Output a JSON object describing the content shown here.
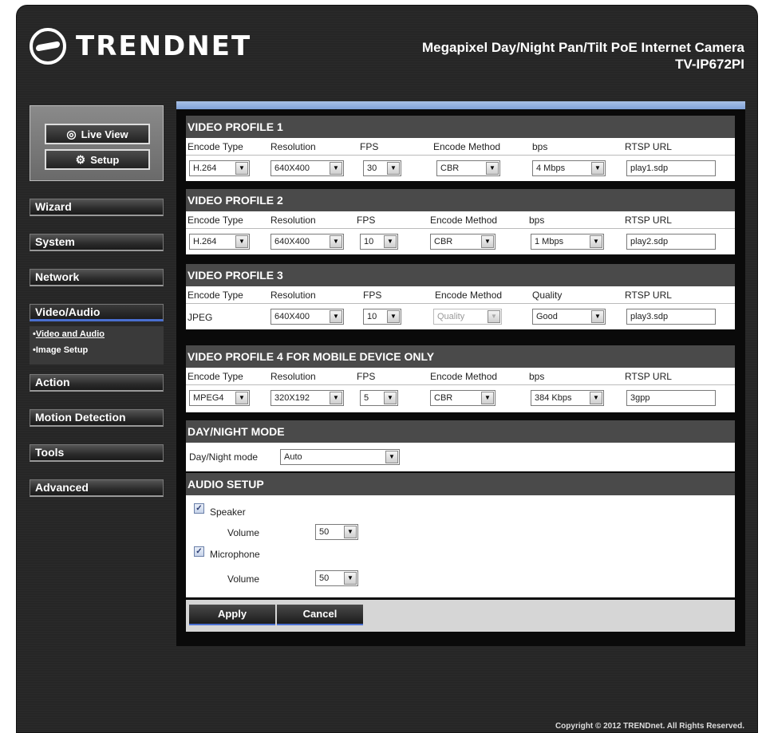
{
  "brand": {
    "logo_text": "TRENDNET"
  },
  "header": {
    "product": "Megapixel Day/Night Pan/Tilt PoE Internet Camera",
    "model": "TV-IP672PI"
  },
  "top_buttons": {
    "live_view": "Live View",
    "setup": "Setup"
  },
  "nav": {
    "wizard": "Wizard",
    "system": "System",
    "network": "Network",
    "video_audio": "Video/Audio",
    "action": "Action",
    "motion_detection": "Motion Detection",
    "tools": "Tools",
    "advanced": "Advanced"
  },
  "subnav": {
    "video_and_audio": "Video and Audio",
    "image_setup": "Image Setup",
    "bullet": "•"
  },
  "profiles": [
    {
      "title": "VIDEO PROFILE 1",
      "headers": [
        "Encode Type",
        "Resolution",
        "FPS",
        "Encode Method",
        "bps",
        "RTSP URL"
      ],
      "encode_type": "H.264",
      "resolution": "640X400",
      "fps": "30",
      "method": "CBR",
      "rate": "4 Mbps",
      "url": "play1.sdp"
    },
    {
      "title": "VIDEO PROFILE 2",
      "headers": [
        "Encode Type",
        "Resolution",
        "FPS",
        "Encode Method",
        "bps",
        "RTSP URL"
      ],
      "encode_type": "H.264",
      "resolution": "640X400",
      "fps": "10",
      "method": "CBR",
      "rate": "1 Mbps",
      "url": "play2.sdp"
    },
    {
      "title": "VIDEO PROFILE 3",
      "headers": [
        "Encode Type",
        "Resolution",
        "FPS",
        "Encode Method",
        "Quality",
        "RTSP URL"
      ],
      "encode_type": "JPEG",
      "resolution": "640X400",
      "fps": "10",
      "method": "Quality",
      "rate": "Good",
      "url": "play3.sdp"
    },
    {
      "title": "VIDEO PROFILE 4 FOR MOBILE DEVICE ONLY",
      "headers": [
        "Encode Type",
        "Resolution",
        "FPS",
        "Encode Method",
        "bps",
        "RTSP URL"
      ],
      "encode_type": "MPEG4",
      "resolution": "320X192",
      "fps": "5",
      "method": "CBR",
      "rate": "384 Kbps",
      "url": "3gpp"
    }
  ],
  "daynight": {
    "title": "DAY/NIGHT MODE",
    "label": "Day/Night mode",
    "value": "Auto"
  },
  "audio": {
    "title": "AUDIO SETUP",
    "speaker": "Speaker",
    "speaker_checked": true,
    "microphone": "Microphone",
    "microphone_checked": true,
    "volume_label": "Volume",
    "speaker_volume": "50",
    "mic_volume": "50"
  },
  "actions": {
    "apply": "Apply",
    "cancel": "Cancel"
  },
  "footer": {
    "copyright": "Copyright © 2012 TRENDnet. All Rights Reserved."
  },
  "icons": {
    "dropdown": "▼",
    "check": "✓",
    "eye": "◎",
    "gears": "⚙"
  },
  "colors": {
    "accent_blue": "#4a6fd0",
    "section_header": "#4a4a4a"
  }
}
